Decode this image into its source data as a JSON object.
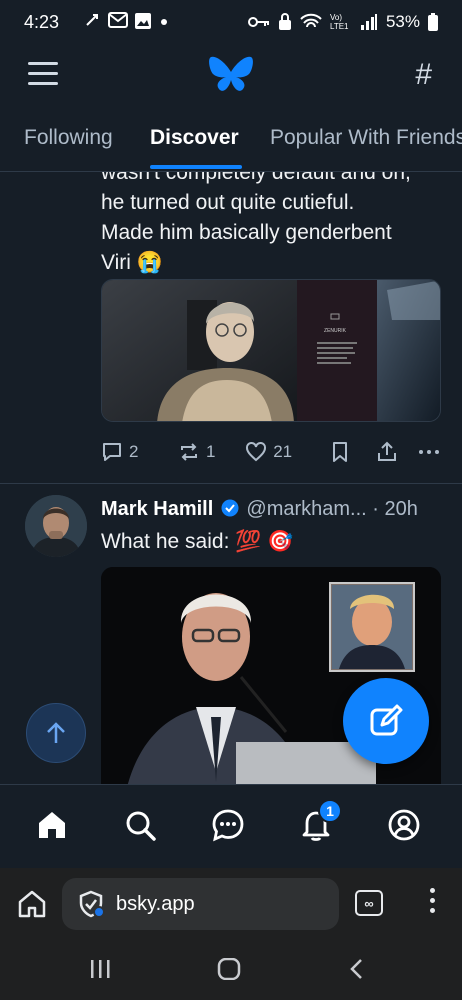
{
  "status_bar": {
    "time": "4:23",
    "battery_text": "53%",
    "signal_label": "Vo) LTE1"
  },
  "app": {
    "name": "Bluesky",
    "accent_color": "#1083fe",
    "background_color": "#161e27"
  },
  "tabs": [
    {
      "label": "Following",
      "active": false
    },
    {
      "label": "Discover",
      "active": true
    },
    {
      "label": "Popular With Friends",
      "active": false
    }
  ],
  "post1": {
    "text_lines": [
      "wasn't completely default and oh,",
      "he turned out quite cutieful.",
      "Made him basically genderbent",
      "Viri 😭"
    ],
    "panel_title": "ZENURIK",
    "counts": {
      "replies": "2",
      "reposts": "1",
      "likes": "21"
    }
  },
  "post2": {
    "author": "Mark Hamill",
    "handle": "@markham...",
    "time": "· 20h",
    "text": "What he said: 💯 🎯"
  },
  "browser": {
    "url": "bsky.app",
    "tab_icon_label": "∞"
  },
  "notifications": {
    "badge_count": "1"
  }
}
